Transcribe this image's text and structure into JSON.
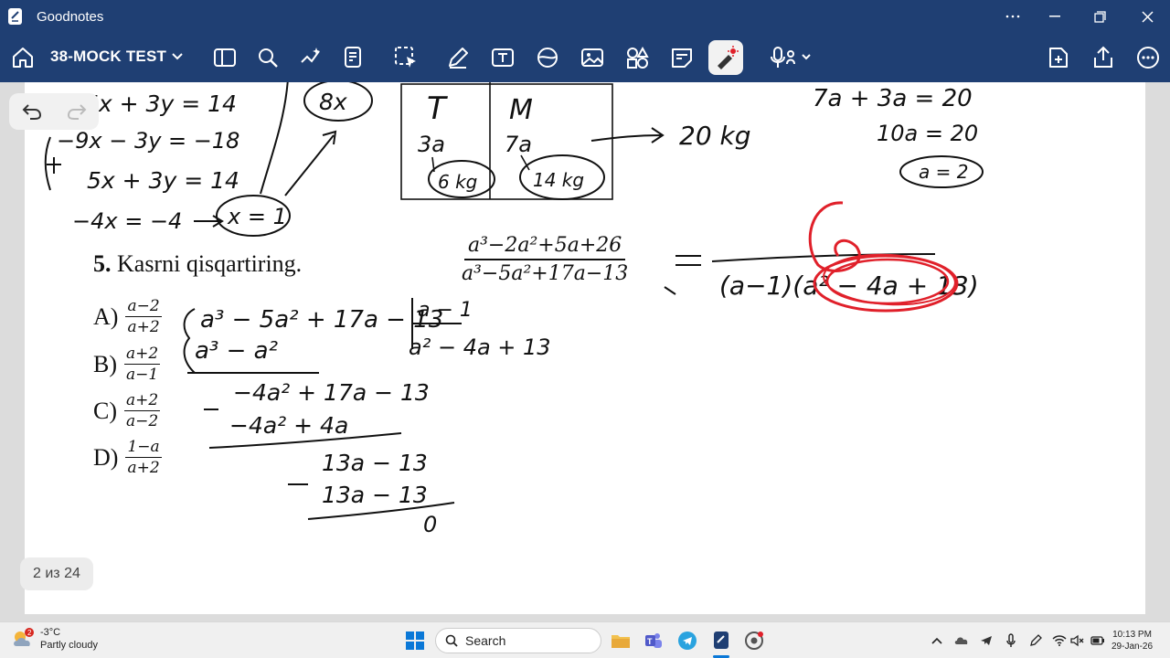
{
  "window": {
    "app_title": "Goodnotes"
  },
  "toolbar": {
    "doc_title": "38-MOCK TEST"
  },
  "page_counter": "2 из 24",
  "worksheet": {
    "question_number": "5.",
    "question_text": "Kasrni qisqartiring.",
    "main_fraction": {
      "numerator": "a³−2a²+5a+26",
      "denominator": "a³−5a²+17a−13"
    },
    "options": [
      {
        "letter": "A)",
        "numerator": "a−2",
        "denominator": "a+2"
      },
      {
        "letter": "B)",
        "numerator": "a+2",
        "denominator": "a−1"
      },
      {
        "letter": "C)",
        "numerator": "a+2",
        "denominator": "a−2"
      },
      {
        "letter": "D)",
        "numerator": "1−a",
        "denominator": "a+2"
      }
    ],
    "table": {
      "headers": [
        "T",
        "M"
      ],
      "row": [
        "3a",
        "7a"
      ],
      "results": [
        "6 kg",
        "14 kg"
      ]
    }
  },
  "handwriting": {
    "arrow_result": "20 kg",
    "eq1": "7a + 3a = 20",
    "eq2": "10a = 20",
    "eq3": "a = 2",
    "sys1": "5x + 3y = 14",
    "sys2": "−9x − 3y = −18",
    "sys3": "5x + 3y = 14",
    "sys4": "−4x = −4",
    "sys_result": "x = 1",
    "circled": "8x",
    "factor": "(a−1)(a² − 4a + 13)",
    "div_dividend": "a³ − 5a² + 17a − 13",
    "div_divisor": "a − 1",
    "div_quotient": "a² − 4a + 13",
    "div_l1": "a³ − a²",
    "div_l2": "−4a² + 17a − 13",
    "div_l3": "−4a² + 4a",
    "div_l4": "13a − 13",
    "div_l5": "13a − 13",
    "div_rem": "0"
  },
  "taskbar": {
    "weather_temp": "-3°C",
    "weather_desc": "Partly cloudy",
    "weather_badge": "2",
    "search_label": "Search",
    "time": "10:13 PM",
    "date": "29-Jan-26"
  },
  "colors": {
    "chrome": "#1f3f73",
    "ink": "#111111",
    "highlight": "#e0202a",
    "page": "#ffffff"
  }
}
